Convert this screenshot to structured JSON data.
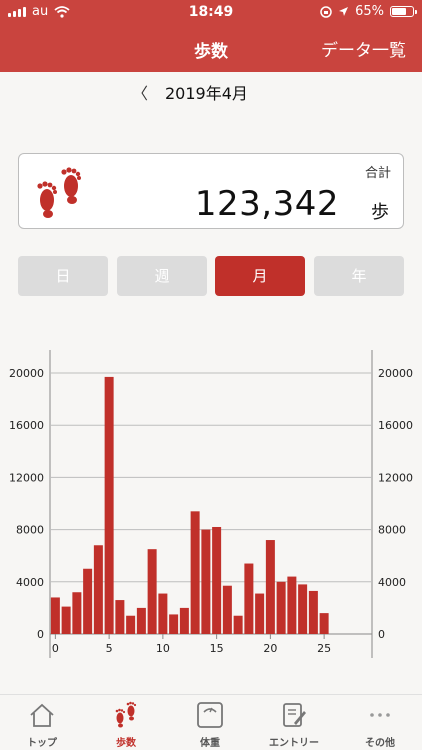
{
  "status_bar": {
    "carrier": "au",
    "time": "18:49",
    "battery": "65%"
  },
  "nav": {
    "title": "歩数",
    "right_button": "データ一覧"
  },
  "month": {
    "prev": "〈",
    "label": "2019年4月"
  },
  "total": {
    "caption": "合計",
    "value": "123,342",
    "unit": "歩"
  },
  "segments": [
    {
      "label": "日",
      "active": false
    },
    {
      "label": "週",
      "active": false
    },
    {
      "label": "月",
      "active": true
    },
    {
      "label": "年",
      "active": false
    }
  ],
  "colors": {
    "header": "#c9443e",
    "accent": "#c0302a",
    "bar": "#c0302a",
    "segment_inactive": "#dcdcdc"
  },
  "chart_data": {
    "type": "bar",
    "x": [
      0,
      1,
      2,
      3,
      4,
      5,
      6,
      7,
      8,
      9,
      10,
      11,
      12,
      13,
      14,
      15,
      16,
      17,
      18,
      19,
      20,
      21,
      22,
      23,
      24,
      25
    ],
    "values": [
      2800,
      2100,
      3200,
      5000,
      6800,
      19700,
      2600,
      1400,
      2000,
      6500,
      3100,
      1500,
      2000,
      9400,
      8000,
      8200,
      3700,
      1400,
      5400,
      3100,
      7200,
      4000,
      4400,
      3800,
      3300,
      1600
    ],
    "x_ticks": [
      "0",
      "5",
      "10",
      "15",
      "20",
      "25"
    ],
    "y_ticks": [
      "0",
      "4000",
      "8000",
      "12000",
      "16000",
      "20000"
    ],
    "ylim": [
      0,
      20000
    ],
    "grid": true,
    "y_axis_both_sides": true
  },
  "tabs": [
    {
      "label": "トップ",
      "icon": "home-icon",
      "active": false
    },
    {
      "label": "歩数",
      "icon": "footprints-icon",
      "active": true
    },
    {
      "label": "体重",
      "icon": "scale-icon",
      "active": false
    },
    {
      "label": "エントリー",
      "icon": "edit-icon",
      "active": false
    },
    {
      "label": "その他",
      "icon": "more-icon",
      "active": false
    }
  ]
}
